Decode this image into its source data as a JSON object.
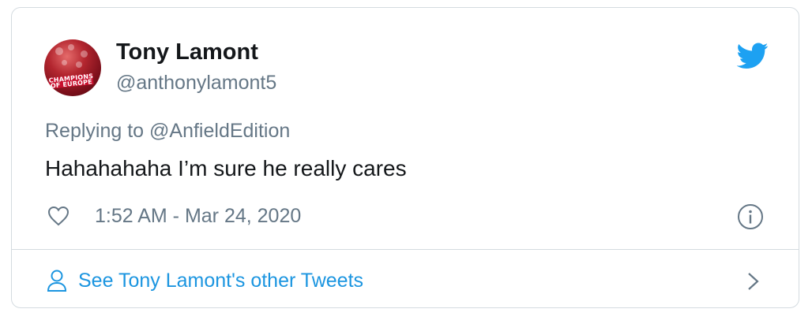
{
  "tweet": {
    "author_name": "Tony Lamont",
    "author_handle": "@anthonylamont5",
    "avatar_banner_text": "CHAMPIONS OF EUROPE",
    "reply_prefix": "Replying to ",
    "reply_target": "@AnfieldEdition",
    "text": "Hahahahaha I’m sure he really cares",
    "timestamp": "1:52 AM - Mar 24, 2020"
  },
  "footer": {
    "link_text": "See Tony Lamont's other Tweets"
  },
  "icons": {
    "brand": "twitter-bird-icon",
    "like": "heart-icon",
    "info": "info-icon",
    "profile": "person-icon",
    "next": "chevron-right-icon"
  },
  "colors": {
    "text_primary": "#14171a",
    "text_secondary": "#657786",
    "link": "#1b95e0",
    "twitter_blue": "#1da1f2",
    "border": "#d4dbe0"
  }
}
